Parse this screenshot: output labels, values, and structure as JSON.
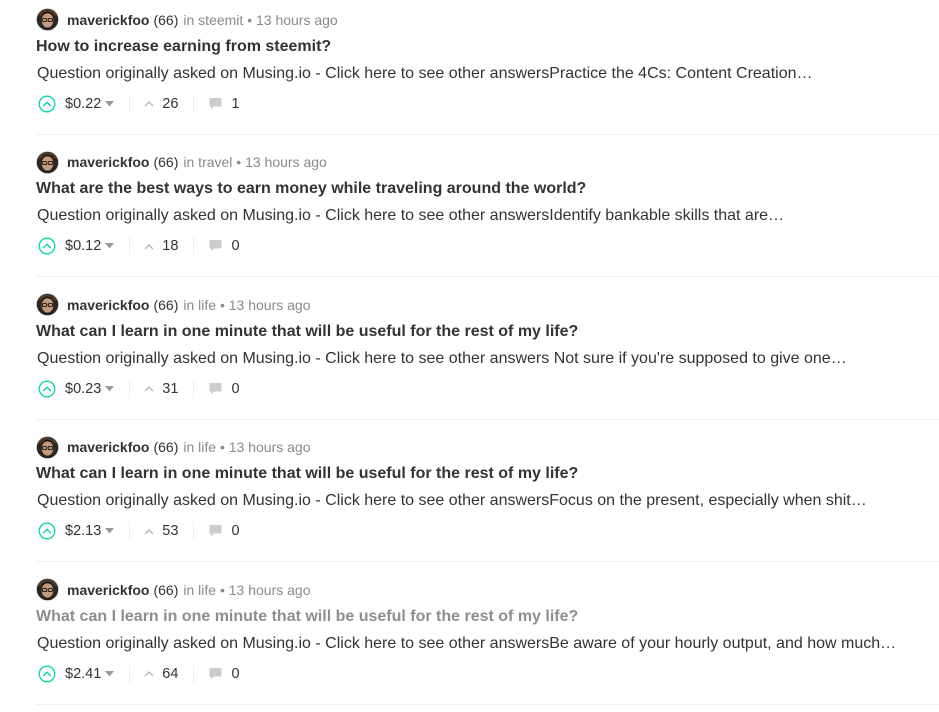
{
  "colors": {
    "accent": "#06d6a9",
    "text": "#333333",
    "muted": "#8a8a8a",
    "divider": "#eeeeee"
  },
  "posts": [
    {
      "author": "maverickfoo",
      "reputation": "(66)",
      "meta": "in steemit • 13 hours ago",
      "title": "How to increase earning from steemit?",
      "excerpt": "Question originally asked on Musing.io - Click here to see other answersPractice the 4Cs: Content Creation…",
      "payout": "$0.22",
      "votes": "26",
      "comments": "1",
      "title_muted": false
    },
    {
      "author": "maverickfoo",
      "reputation": "(66)",
      "meta": "in travel • 13 hours ago",
      "title": "What are the best ways to earn money while traveling around the world?",
      "excerpt": "Question originally asked on Musing.io - Click here to see other answersIdentify bankable skills that are…",
      "payout": "$0.12",
      "votes": "18",
      "comments": "0",
      "title_muted": false
    },
    {
      "author": "maverickfoo",
      "reputation": "(66)",
      "meta": "in life • 13 hours ago",
      "title": "What can I learn in one minute that will be useful for the rest of my life?",
      "excerpt": "Question originally asked on Musing.io - Click here to see other answers Not sure if you're supposed to give one…",
      "payout": "$0.23",
      "votes": "31",
      "comments": "0",
      "title_muted": false
    },
    {
      "author": "maverickfoo",
      "reputation": "(66)",
      "meta": "in life • 13 hours ago",
      "title": "What can I learn in one minute that will be useful for the rest of my life?",
      "excerpt": "Question originally asked on Musing.io - Click here to see other answersFocus on the present, especially when shit…",
      "payout": "$2.13",
      "votes": "53",
      "comments": "0",
      "title_muted": false
    },
    {
      "author": "maverickfoo",
      "reputation": "(66)",
      "meta": "in life • 13 hours ago",
      "title": "What can I learn in one minute that will be useful for the rest of my life?",
      "excerpt": "Question originally asked on Musing.io - Click here to see other answersBe aware of your hourly output, and how much…",
      "payout": "$2.41",
      "votes": "64",
      "comments": "0",
      "title_muted": true
    }
  ]
}
